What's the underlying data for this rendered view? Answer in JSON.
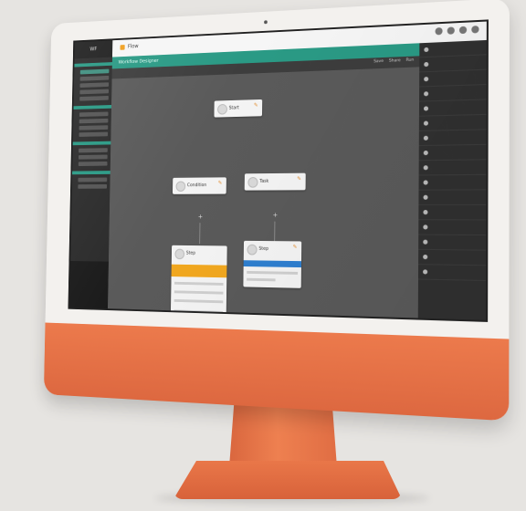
{
  "app": {
    "brand": "WF",
    "badge": "Flow",
    "title": "Workflow Designer"
  },
  "toolbar": {
    "actions": [
      "Save",
      "Share",
      "Run"
    ]
  },
  "sidebar": {
    "sections": [
      {
        "items": [
          "",
          "",
          "",
          "",
          ""
        ]
      },
      {
        "items": [
          "",
          "",
          "",
          ""
        ]
      },
      {
        "items": [
          "",
          "",
          ""
        ]
      },
      {
        "items": [
          "",
          ""
        ]
      }
    ]
  },
  "right_panel": {
    "rows": [
      "",
      "",
      "",
      "",
      "",
      "",
      "",
      "",
      "",
      "",
      "",
      "",
      "",
      "",
      "",
      "",
      "",
      ""
    ]
  },
  "nodes": {
    "top": {
      "label": "Start"
    },
    "left": {
      "label": "Condition"
    },
    "right": {
      "label": "Task"
    },
    "card_a": {
      "label": "Step"
    },
    "card_b": {
      "label": "Step"
    }
  },
  "colors": {
    "accent": "#2a9a85",
    "orange": "#f2a81f",
    "blue": "#2e7fd0",
    "monitor": "#ec7a4c"
  }
}
